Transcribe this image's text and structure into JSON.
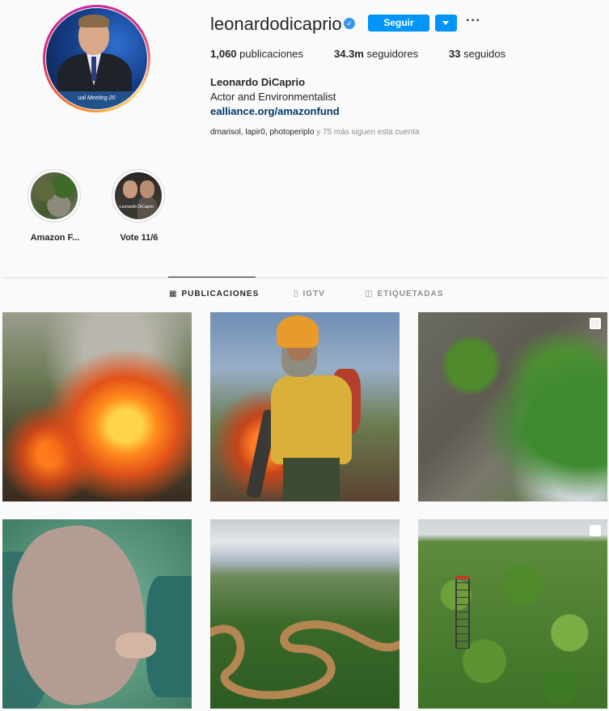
{
  "profile": {
    "username": "leonardodicaprio",
    "verified": true,
    "follow_label": "Seguir",
    "more_label": "···",
    "avatar_banner": "ual Meeting 20",
    "stats": [
      {
        "count": "1,060",
        "label": "publicaciones"
      },
      {
        "count": "34.3m",
        "label": "seguidores"
      },
      {
        "count": "33",
        "label": "seguidos"
      }
    ],
    "full_name": "Leonardo DiCaprio",
    "bio": "Actor and Environmentalist",
    "link": "ealliance.org/amazonfund",
    "followed_by_names": "dmarisol, lapir0, photoperiplo",
    "followed_by_suffix": " y 75 más siguen esta cuenta"
  },
  "highlights": [
    {
      "label": "Amazon F..."
    },
    {
      "label": "Vote 11/6",
      "thumb_caption": "Leonardo DiCaprio"
    }
  ],
  "tabs": [
    {
      "label": "PUBLICACIONES",
      "icon": "grid-icon",
      "active": true
    },
    {
      "label": "IGTV",
      "icon": "igtv-icon",
      "active": false
    },
    {
      "label": "ETIQUETADAS",
      "icon": "tagged-icon",
      "active": false
    }
  ],
  "colors": {
    "accent": "#0095f6",
    "link": "#00376b",
    "muted": "#8e8e8e",
    "background": "#fafafa"
  }
}
